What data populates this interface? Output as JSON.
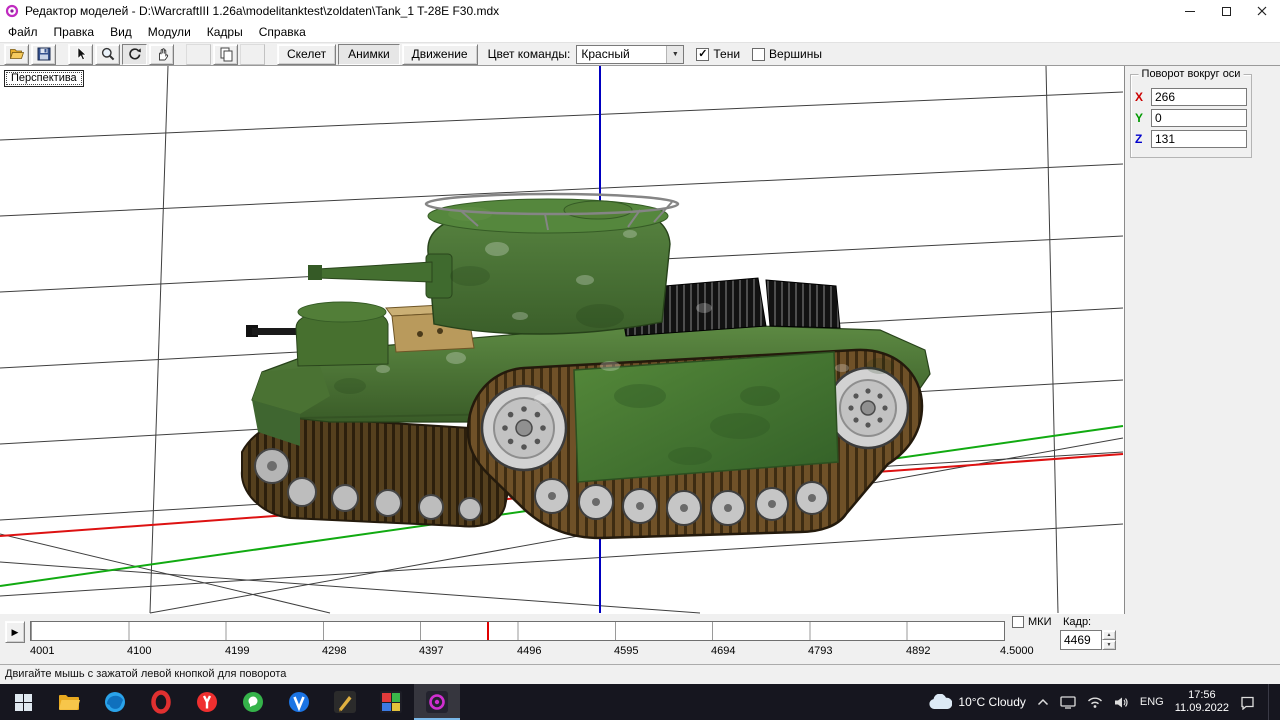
{
  "window": {
    "title": "Редактор моделей - D:\\WarcraftIII 1.26a\\modelitanktest\\zoldaten\\Tank_1 T-28E F30.mdx"
  },
  "menu": {
    "items": [
      "Файл",
      "Правка",
      "Вид",
      "Модули",
      "Кадры",
      "Справка"
    ]
  },
  "toolbar": {
    "tabs": [
      "Скелет",
      "Анимки",
      "Движение"
    ],
    "team_color_label": "Цвет команды:",
    "team_color_value": "Красный",
    "shadows_label": "Тени",
    "vertices_label": "Вершины"
  },
  "viewport": {
    "label": "Перспектива"
  },
  "rotation_panel": {
    "title": "Поворот вокруг оси",
    "axes": [
      {
        "label": "X",
        "value": "266"
      },
      {
        "label": "Y",
        "value": "0"
      },
      {
        "label": "Z",
        "value": "131"
      }
    ]
  },
  "timeline": {
    "ticks": [
      "4001",
      "4100",
      "4199",
      "4298",
      "4397",
      "4496",
      "4595",
      "4694",
      "4793",
      "4892",
      "4.5000"
    ],
    "mki_label": "МКИ",
    "frame_label": "Кадр:",
    "frame_value": "4469"
  },
  "status_bar": {
    "text": "Двигайте мышь с зажатой левой кнопкой для поворота"
  },
  "taskbar": {
    "weather": "10°C Cloudy",
    "language": "ENG",
    "time": "17:56",
    "date": "11.09.2022"
  },
  "icons": {
    "play": "▶",
    "check": "✓",
    "dropdown_arrow": "▼",
    "spinner_up": "▲",
    "spinner_down": "▼"
  },
  "colors": {
    "axis_x": "#dd1111",
    "axis_y": "#11aa11",
    "axis_z": "#0000c0",
    "frame_marker": "#e00000",
    "tank_green": "#4a7c36"
  }
}
